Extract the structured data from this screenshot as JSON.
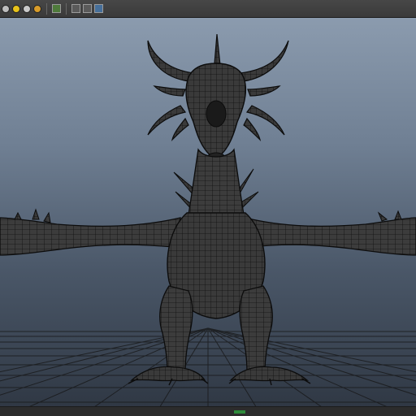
{
  "toolbar": {
    "buttons": [
      {
        "name": "wireframe-shading-icon"
      },
      {
        "name": "smooth-shading-icon"
      },
      {
        "name": "lighting-icon"
      },
      {
        "name": "shadows-icon"
      },
      {
        "name": "textured-icon"
      },
      {
        "name": "isolate-select-icon"
      },
      {
        "name": "xray-icon"
      },
      {
        "name": "resolution-gate-icon"
      },
      {
        "name": "camera-tool-icon"
      }
    ]
  },
  "colors": {
    "mesh_fill": "#3b3b3b",
    "wire": "#111111",
    "grid": "#1a1a1a",
    "axis_marker": "#2e8a3a"
  },
  "viewport": {
    "object": "dragon-mesh"
  }
}
